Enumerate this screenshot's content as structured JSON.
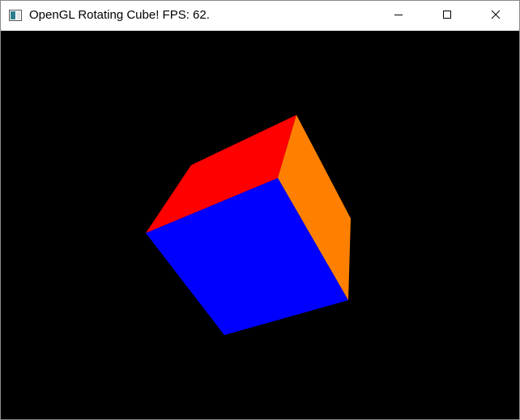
{
  "window": {
    "title": "OpenGL Rotating Cube! FPS: 62.",
    "icon": "application-window-icon"
  },
  "titlebar_buttons": [
    {
      "name": "minimize",
      "icon": "minimize-icon"
    },
    {
      "name": "maximize",
      "icon": "maximize-icon"
    },
    {
      "name": "close",
      "icon": "close-icon"
    }
  ],
  "viewport": {
    "background": "#000000",
    "cube_faces": [
      {
        "name": "top-face",
        "color": "#ff0000"
      },
      {
        "name": "right-face",
        "color": "#ff8000"
      },
      {
        "name": "front-face",
        "color": "#0000ff"
      }
    ]
  }
}
